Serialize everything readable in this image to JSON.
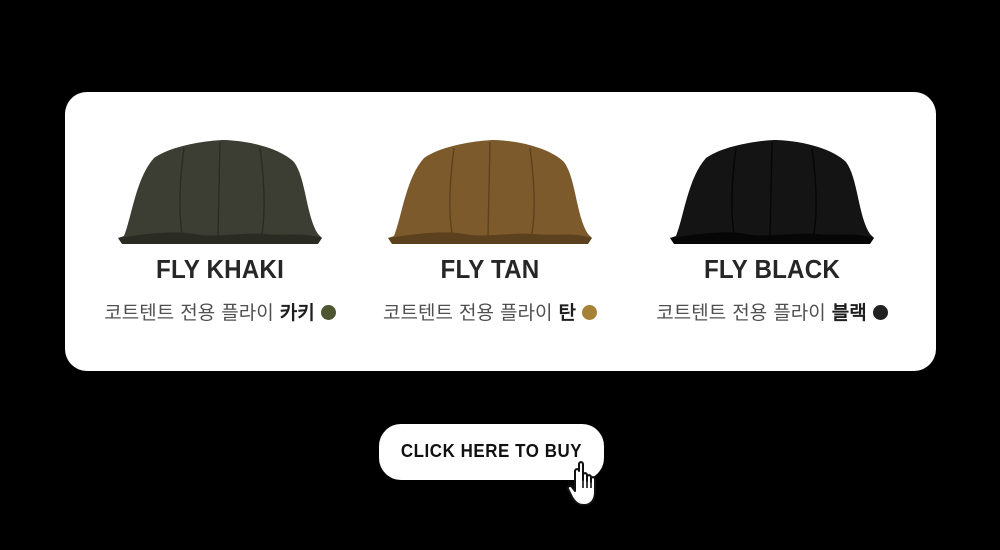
{
  "colors": {
    "background": "#000000",
    "card": "#ffffff",
    "text_dark": "#262626",
    "text_muted": "#505050"
  },
  "products": [
    {
      "name": "FLY KHAKI",
      "desc_prefix": "코트텐트 전용 플라이",
      "desc_color_name": "카키",
      "swatch_color": "#4e5631",
      "tent_color": "#3c3e33",
      "tent_shade": "#2a2c24"
    },
    {
      "name": "FLY TAN",
      "desc_prefix": "코트텐트 전용 플라이",
      "desc_color_name": "탄",
      "swatch_color": "#a58236",
      "tent_color": "#7d5a2c",
      "tent_shade": "#5c411e"
    },
    {
      "name": "FLY BLACK",
      "desc_prefix": "코트텐트 전용 플라이",
      "desc_color_name": "블랙",
      "swatch_color": "#222222",
      "tent_color": "#141414",
      "tent_shade": "#060606"
    }
  ],
  "cta": {
    "label": "CLICK HERE TO BUY",
    "icon": "hand-pointer-icon"
  }
}
